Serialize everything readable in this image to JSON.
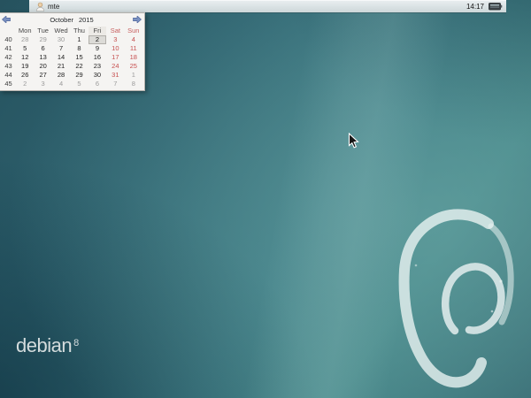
{
  "panel": {
    "menu": {
      "label": "mte",
      "icon": "user-avatar-icon"
    },
    "clock": {
      "time": "14:17"
    },
    "battery": {
      "icon": "battery-ac-icon"
    }
  },
  "calendar": {
    "month": "October",
    "year": "2015",
    "nav": {
      "prev_icon": "arrow-left-icon",
      "next_icon": "arrow-right-icon"
    },
    "day_headers": [
      "Mon",
      "Tue",
      "Wed",
      "Thu",
      "Fri",
      "Sat",
      "Sun"
    ],
    "today_column_index": 4,
    "week_numbers": [
      "40",
      "41",
      "42",
      "43",
      "44",
      "45"
    ],
    "selected_day": "2",
    "rows": [
      [
        {
          "v": "28",
          "k": "out"
        },
        {
          "v": "29",
          "k": "out"
        },
        {
          "v": "30",
          "k": "out"
        },
        {
          "v": "1",
          "k": "norm"
        },
        {
          "v": "2",
          "k": "sel"
        },
        {
          "v": "3",
          "k": "wend"
        },
        {
          "v": "4",
          "k": "wend"
        }
      ],
      [
        {
          "v": "5",
          "k": "norm"
        },
        {
          "v": "6",
          "k": "norm"
        },
        {
          "v": "7",
          "k": "norm"
        },
        {
          "v": "8",
          "k": "norm"
        },
        {
          "v": "9",
          "k": "norm"
        },
        {
          "v": "10",
          "k": "wend"
        },
        {
          "v": "11",
          "k": "wend"
        }
      ],
      [
        {
          "v": "12",
          "k": "norm"
        },
        {
          "v": "13",
          "k": "norm"
        },
        {
          "v": "14",
          "k": "norm"
        },
        {
          "v": "15",
          "k": "norm"
        },
        {
          "v": "16",
          "k": "norm"
        },
        {
          "v": "17",
          "k": "wend"
        },
        {
          "v": "18",
          "k": "wend"
        }
      ],
      [
        {
          "v": "19",
          "k": "norm"
        },
        {
          "v": "20",
          "k": "norm"
        },
        {
          "v": "21",
          "k": "norm"
        },
        {
          "v": "22",
          "k": "norm"
        },
        {
          "v": "23",
          "k": "norm"
        },
        {
          "v": "24",
          "k": "wend"
        },
        {
          "v": "25",
          "k": "wend"
        }
      ],
      [
        {
          "v": "26",
          "k": "norm"
        },
        {
          "v": "27",
          "k": "norm"
        },
        {
          "v": "28",
          "k": "norm"
        },
        {
          "v": "29",
          "k": "norm"
        },
        {
          "v": "30",
          "k": "norm"
        },
        {
          "v": "31",
          "k": "wend"
        },
        {
          "v": "1",
          "k": "out"
        }
      ],
      [
        {
          "v": "2",
          "k": "out"
        },
        {
          "v": "3",
          "k": "out"
        },
        {
          "v": "4",
          "k": "out"
        },
        {
          "v": "5",
          "k": "out"
        },
        {
          "v": "6",
          "k": "out"
        },
        {
          "v": "7",
          "k": "out"
        },
        {
          "v": "8",
          "k": "out"
        }
      ]
    ]
  },
  "desktop": {
    "wordmark": {
      "text": "debian",
      "version": "8"
    },
    "logo": "debian-swirl-logo",
    "colors": {
      "base_teal": "#2e6370",
      "dark_corner": "#234c59",
      "highlight_teal": "#4f8f92",
      "panel_gray": "#dde4e6",
      "weekend_red": "#c64f4f",
      "swirl": "#e9f2f1"
    }
  },
  "cursor": "arrow-cursor"
}
